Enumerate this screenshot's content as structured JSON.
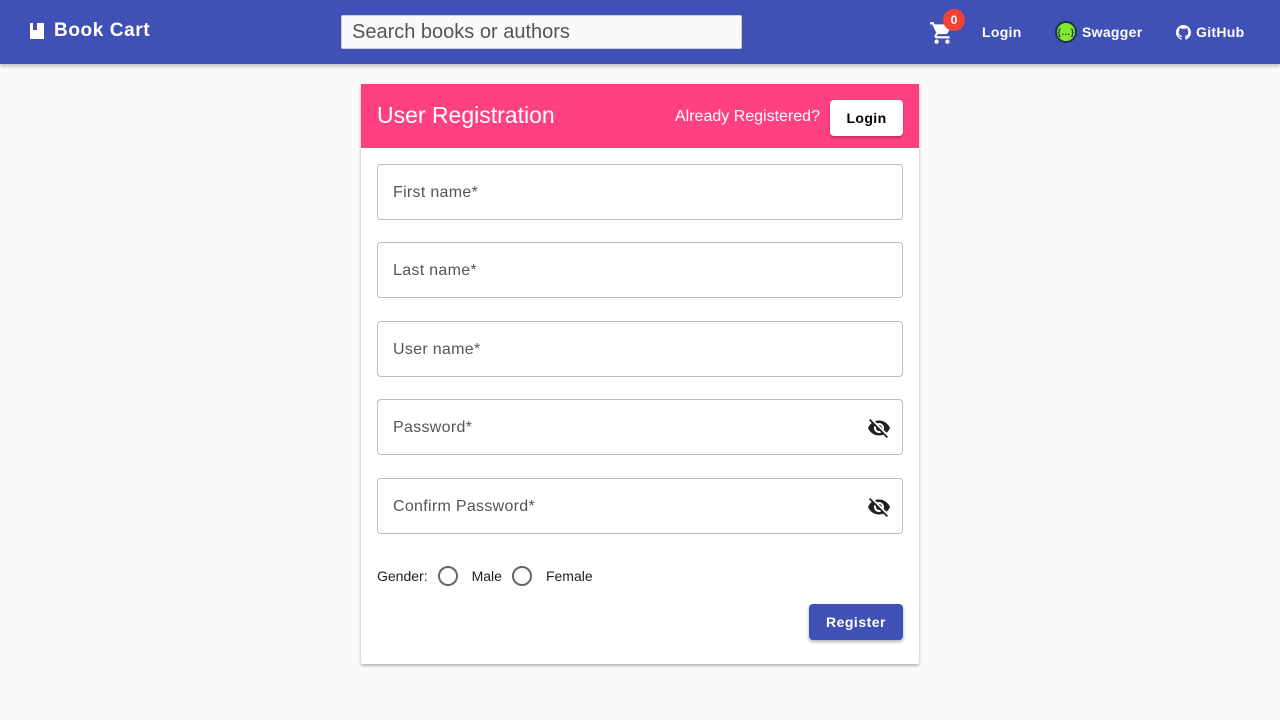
{
  "colors": {
    "toolbar": "#3f51b5",
    "accent": "#ff4081",
    "badge": "#f44336",
    "page_background": "#fafafa"
  },
  "toolbar": {
    "brand_icon": "book-icon",
    "brand": "Book Cart",
    "search_placeholder": "Search books or authors",
    "cart_icon": "shopping-cart-icon",
    "cart_count": "0",
    "login": "Login",
    "swagger_icon": "swagger-icon",
    "swagger": "Swagger",
    "github_icon": "github-icon",
    "github": "GitHub"
  },
  "registration": {
    "title": "User Registration",
    "already_registered": "Already Registered?",
    "login_button": "Login",
    "fields": {
      "first_name": "First name*",
      "last_name": "Last name*",
      "user_name": "User name*",
      "password": "Password*",
      "confirm_password": "Confirm Password*"
    },
    "visibility_icon": "visibility-off-icon",
    "gender_label": "Gender:",
    "gender_options": [
      "Male",
      "Female"
    ],
    "register_button": "Register"
  }
}
